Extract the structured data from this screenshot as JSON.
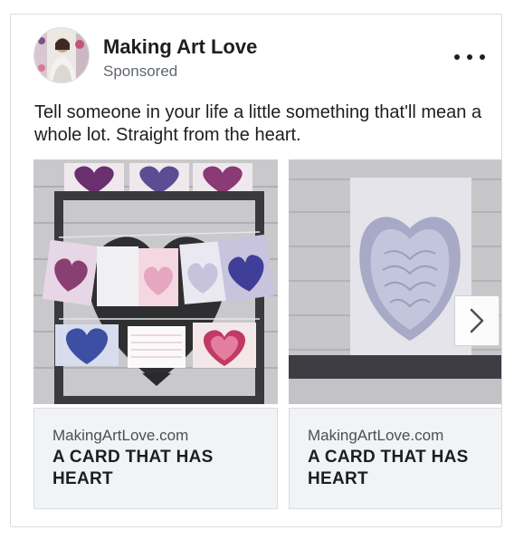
{
  "post": {
    "page_name": "Making Art Love",
    "sponsored_label": "Sponsored",
    "message": "Tell someone in your life a little something that'll mean a whole lot. Straight from the heart."
  },
  "carousel": {
    "cards": [
      {
        "domain": "MakingArtLove.com",
        "title": "A CARD THAT HAS HEART"
      },
      {
        "domain": "MakingArtLove.com",
        "title": "A CARD THAT HAS HEART"
      }
    ],
    "next_icon": "chevron-right-icon"
  },
  "colors": {
    "text_primary": "#1c1e21",
    "text_secondary": "#606770",
    "card_footer_bg": "#f2f3f5",
    "border": "#dadde1"
  }
}
